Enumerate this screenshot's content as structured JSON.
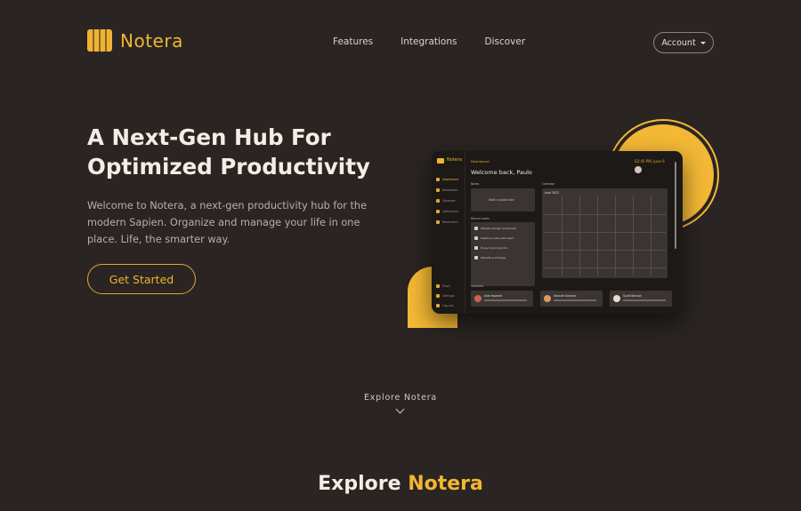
{
  "brand": {
    "name": "Notera",
    "color": "#f3b533"
  },
  "nav": {
    "links": [
      "Features",
      "Integrations",
      "Discover"
    ],
    "account": "Account"
  },
  "hero": {
    "title_line1": "A Next-Gen Hub For",
    "title_line2": "Optimized Productivity",
    "description": "Welcome to Notera, a next-gen productivity hub for the modern Sapien. Organize and manage your life in one place. Life, the smarter way.",
    "cta": "Get Started"
  },
  "mockup": {
    "logo": "Notera",
    "nav": [
      "Dashboard",
      "Notebooks",
      "Calendar",
      "Collections",
      "Reminders"
    ],
    "bottom_nav": [
      "Trash",
      "Settings",
      "Log out"
    ],
    "crumb": "Dashboard",
    "welcome": "Welcome back, Paulo",
    "time": "02:45 PM, June 6",
    "quick_note": "Start a quick note",
    "sections": {
      "notes": "Notes",
      "recent": "Recent notes",
      "calendar": "Calendar",
      "contacts": "Contacts"
    },
    "recent_notes": [
      "Website Design Guidelines",
      "Meeting notes with team",
      "Project planning doc",
      "Marketing strategy"
    ],
    "calendar_month": "June 2022",
    "contacts": [
      "Julia Howard",
      "Hannah Briones",
      "Scott Benson"
    ]
  },
  "explore": {
    "link": "Explore Notera",
    "title_plain": "Explore",
    "title_accent": "Notera"
  },
  "colors": {
    "background": "#2a2523",
    "accent": "#f3b533",
    "text": "#f3ede6"
  },
  "icons": [
    "logo-icon",
    "caret-down-icon",
    "chevron-down-icon"
  ]
}
